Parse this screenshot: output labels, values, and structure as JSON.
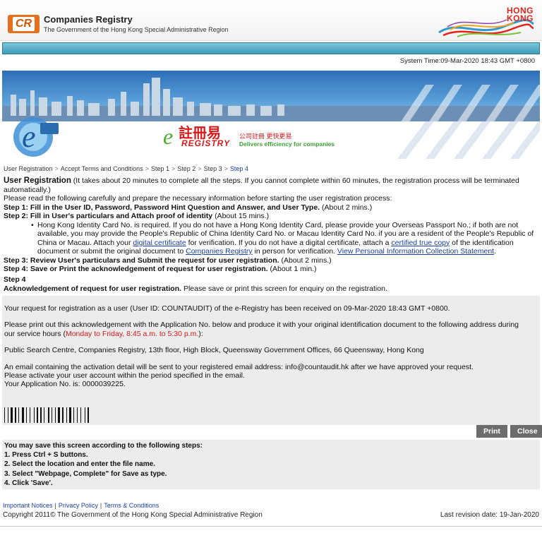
{
  "header": {
    "logo_text": "CR",
    "org_name": "Companies Registry",
    "org_sub": "The Government of the Hong Kong Special Administrative Region",
    "hk_logo_line1": "HONG",
    "hk_logo_line2": "KONG"
  },
  "system_time": "System Time:09-Mar-2020 18:43 GMT +0800",
  "banner": {
    "brand_chinese": "註冊易",
    "brand_registry": "REGISTRY",
    "tagline_chinese": "公司註冊 更快更易",
    "tagline": "Delivers efficiency for companies"
  },
  "breadcrumb": [
    "User Registration",
    "Accept Terms and Conditions",
    "Step 1",
    "Step 2",
    "Step 3",
    "Step 4"
  ],
  "instructions": {
    "title": "User Registration",
    "title_note": " (It takes about 20 minutes to complete all the steps. If you cannot complete within 60 minutes, the registration process will be terminated automatically.)",
    "intro": "Please read the following carefully and prepare the necessary information before starting the user registration process:",
    "step1_bold": "Step 1: Fill in the User ID, Password, Password Hint Question and Answer, and User Type.",
    "step1_time": " (About 2 mins.)",
    "step2_bold": "Step 2: Fill in User's particulars and Attach proof of identity",
    "step2_time": " (About 15 mins.)",
    "bullet_part1": "Hong Kong Identity Card No. is required. If you do not have a Hong Kong Identity Card, please provide your Overseas Passport No.; if both are not available, you may provide the People's Republic of China Identity Card No. or Macau Identity Card No. if you are a resident of the People's Republic of China or Macau. Attach your ",
    "link_digital_certificate": "digital certificate",
    "bullet_part2": " for verification. If you do not have a digital certificate, attach a ",
    "link_certified_copy": "certified true copy",
    "bullet_part3": " of the identification document or submit the original document to ",
    "link_companies_registry": "Companies Registry",
    "bullet_part4": " in person for verification. ",
    "link_pics": "View Personal Information Collection Statement",
    "bullet_part5": ".",
    "step3_bold": "Step 3: Review User's particulars and Submit the request for user registration.",
    "step3_time": " (About 2 mins.)",
    "step4_bold": "Step 4: Save or Print the acknowledgement of request for user registration.",
    "step4_time": " (About 1 min.)"
  },
  "step4": {
    "heading": "Step 4",
    "ack_bold": "Acknowledgement of request for user registration.",
    "ack_rest": " Please save or print this screen for enquiry on the registration."
  },
  "acknowledgement": {
    "received": "Your request for registration as a user (User ID: COUNTAUDIT) of the e-Registry has been received on 09-Mar-2020 18:43 GMT +0800.",
    "print_out": "Please print out this acknowledgement with the Application No. below and produce it with your original identification document to the following address during our service hours (",
    "service_hours": "Monday to Friday, 8:45 a.m. to 5:30 p.m.",
    "print_out_end": "):",
    "address": "Public Search Centre, Companies Registry, 13th floor, High Block, Queensway Government Offices, 66 Queensway, Hong Kong",
    "email_line": "An email containing the activation detail will be sent to your registered email address: info@countaudit.hk after we have approved your request.",
    "activate_line": "Please activate your user account within the period specified in the email.",
    "app_no_line": "Your Application No. is: 0000039225."
  },
  "buttons": {
    "print": "Print",
    "close": "Close"
  },
  "save_steps": {
    "heading": "You may save this screen according to the following steps:",
    "step1": "1. Press Ctrl + S buttons.",
    "step2": "2. Select the location and enter the file name.",
    "step3": "3. Select \"Webpage, Complete\" for Save as type.",
    "step4": "4. Click 'Save'."
  },
  "footer": {
    "links": [
      "Important Notices",
      "Privacy Policy",
      "Terms & Conditions"
    ],
    "copyright": "Copyright 2011© The Government of the Hong Kong Special Administrative Region",
    "revision": "Last revision date: 19-Jan-2020"
  }
}
